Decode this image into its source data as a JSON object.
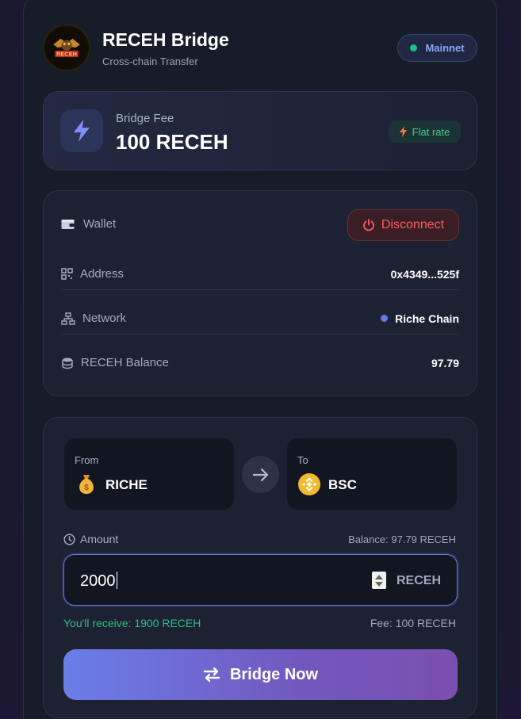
{
  "header": {
    "title": "RECEH Bridge",
    "subtitle": "Cross-chain Transfer",
    "logo_text": "RECEH",
    "network_badge": "Mainnet"
  },
  "fee_panel": {
    "label": "Bridge Fee",
    "value": "100 RECEH",
    "badge": "Flat rate"
  },
  "wallet": {
    "title": "Wallet",
    "disconnect_label": "Disconnect",
    "rows": [
      {
        "label": "Address",
        "value": "0x4349...525f",
        "icon": "qr-icon"
      },
      {
        "label": "Network",
        "value": "Riche Chain",
        "icon": "network-icon"
      },
      {
        "label": "RECEH Balance",
        "value": "97.79",
        "icon": "coins-icon"
      }
    ]
  },
  "transfer": {
    "from_caption": "From",
    "from_chain": "RICHE",
    "from_icon": "money-bag-icon",
    "to_caption": "To",
    "to_chain": "BSC",
    "to_icon": "bnb-icon",
    "amount_label": "Amount",
    "balance_text": "Balance: 97.79 RECEH",
    "amount_value": "2000",
    "amount_unit": "RECEH",
    "receive_text": "You'll receive: 1900 RECEH",
    "fee_text": "Fee: 100 RECEH",
    "button_label": "Bridge Now"
  },
  "colors": {
    "accent": "#6a7ee8",
    "success": "#19c28a",
    "danger": "#ff5a5f"
  }
}
